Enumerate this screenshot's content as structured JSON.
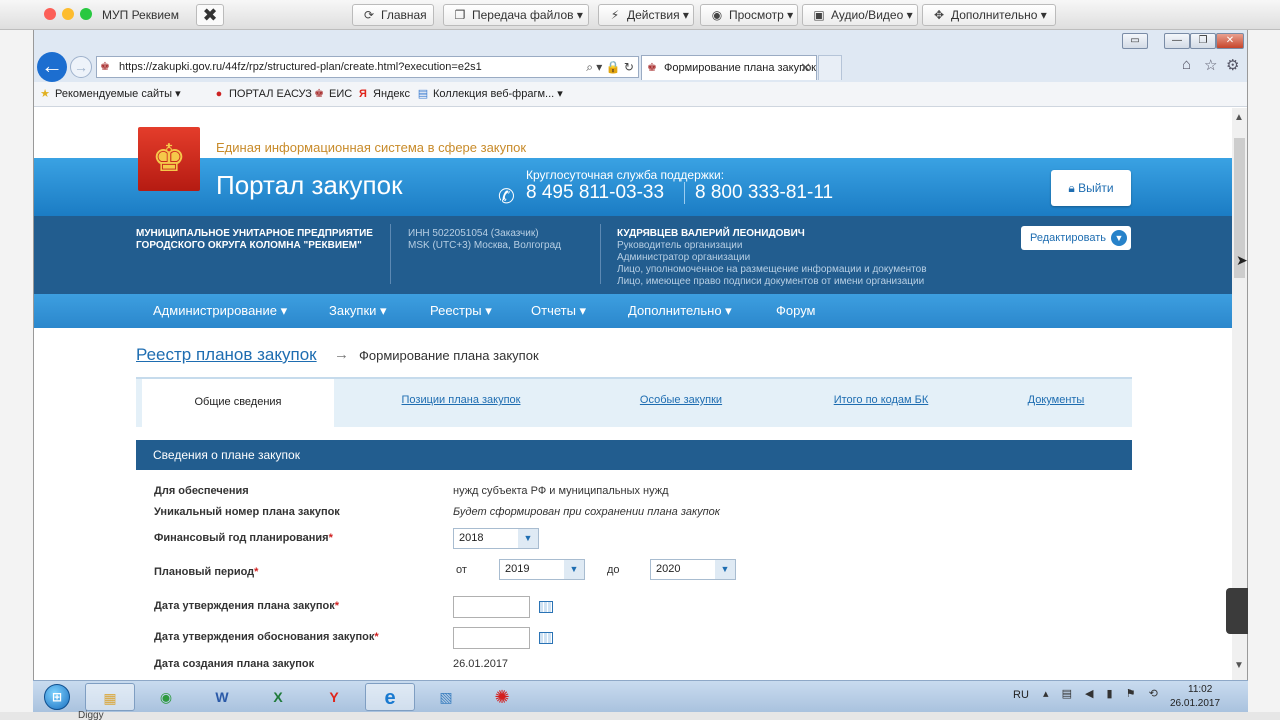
{
  "tv": {
    "window_title": "МУП Реквием",
    "close_glyph": "✖",
    "buttons": [
      {
        "icon": "⟳",
        "label": "Главная"
      },
      {
        "icon": "❐",
        "label": "Передача файлов ▾"
      },
      {
        "icon": "⚡",
        "label": "Действия ▾"
      },
      {
        "icon": "◉",
        "label": "Просмотр ▾"
      },
      {
        "icon": "▣",
        "label": "Аудио/Видео ▾"
      },
      {
        "icon": "✥",
        "label": "Дополнительно ▾"
      }
    ]
  },
  "browser": {
    "url": "https://zakupki.gov.ru/44fz/rpz/structured-plan/create.html?execution=e2s1",
    "url_tools": "⌕ ▾ 🔒 ↻",
    "tab_title": "Формирование плана закупок",
    "tab_close": "✕",
    "favorites": [
      {
        "icon": "★",
        "label": "Рекомендуемые сайты ▾"
      },
      {
        "icon": "●",
        "label": "ПОРТАЛ ЕАСУЗ"
      },
      {
        "icon": "♚",
        "label": "ЕИС"
      },
      {
        "icon": "Я",
        "label": "Яндекс"
      },
      {
        "icon": "▤",
        "label": "Коллекция веб-фрагм... ▾"
      }
    ]
  },
  "portal": {
    "subtitle": "Единая информационная система в сфере закупок",
    "title": "Портал закупок",
    "support_label": "Круглосуточная служба поддержки:",
    "phone1": "8 495 811-03-33",
    "phone2": "8 800 333-81-11",
    "logout": "Выйти"
  },
  "org": {
    "name_line1": "МУНИЦИПАЛЬНОЕ УНИТАРНОЕ ПРЕДПРИЯТИЕ",
    "name_line2": "ГОРОДСКОГО ОКРУГА КОЛОМНА \"РЕКВИЕМ\"",
    "inn": "ИНН 5022051054 (Заказчик)",
    "tz": "MSK (UTC+3) Москва, Волгоград",
    "user_name": "КУДРЯВЦЕВ ВАЛЕРИЙ ЛЕОНИДОВИЧ",
    "roles": [
      "Руководитель организации",
      "Администратор организации",
      "Лицо, уполномоченное на размещение информации и документов",
      "Лицо, имеющее право подписи документов от имени организации"
    ],
    "edit": "Редактировать"
  },
  "menu": [
    "Администрирование ▾",
    "Закупки ▾",
    "Реестры ▾",
    "Отчеты ▾",
    "Дополнительно ▾",
    "Форум"
  ],
  "breadcrumb": {
    "root": "Реестр планов закупок",
    "arrow": "→",
    "current": "Формирование плана закупок"
  },
  "tabs": [
    "Общие сведения",
    "Позиции плана закупок",
    "Особые закупки",
    "Итого по кодам БК",
    "Документы"
  ],
  "section": {
    "title": "Сведения о плане закупок",
    "fields": {
      "purpose_label": "Для обеспечения",
      "purpose_value": "нужд субъекта РФ и муниципальных нужд",
      "unique_label": "Уникальный номер плана закупок",
      "unique_value": "Будет сформирован при сохранении плана закупок",
      "fin_year_label": "Финансовый год планирования",
      "fin_year_value": "2018",
      "period_label": "Плановый период",
      "period_from_label": "от",
      "period_from": "2019",
      "period_to_label": "до",
      "period_to": "2020",
      "approve_date_label": "Дата утверждения плана закупок",
      "justif_date_label": "Дата утверждения обоснования закупок",
      "created_label": "Дата создания плана закупок",
      "created_value": "26.01.2017"
    },
    "required_mark": "*"
  },
  "taskbar": {
    "start": "⊞",
    "apps": [
      {
        "name": "explorer",
        "glyph": "▦",
        "color": "#d9a63a"
      },
      {
        "name": "chrome",
        "glyph": "◉",
        "color": "#2e9a3f"
      },
      {
        "name": "word",
        "glyph": "W",
        "color": "#2b5aa8"
      },
      {
        "name": "excel",
        "glyph": "X",
        "color": "#1f7a3a"
      },
      {
        "name": "yandex",
        "glyph": "Y",
        "color": "#e0251b"
      },
      {
        "name": "ie",
        "glyph": "e",
        "color": "#1a7ad0"
      },
      {
        "name": "photos",
        "glyph": "▧",
        "color": "#3b7fbf"
      },
      {
        "name": "paint",
        "glyph": "✺",
        "color": "#d41f1f"
      }
    ],
    "lang": "RU",
    "tray": "▴ ▤ ◀ ▮ ⚑ ⟲",
    "time": "11:02",
    "date": "26.01.2017",
    "diggy": "Diggy"
  }
}
